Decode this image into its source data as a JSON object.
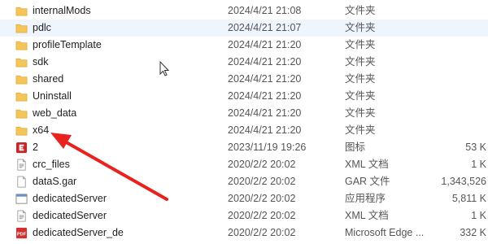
{
  "file_list": {
    "rows": [
      {
        "name": "internalMods",
        "date": "2024/4/21 21:08",
        "type": "文件夹",
        "size": "",
        "icon": "folder-icon"
      },
      {
        "name": "pdlc",
        "date": "2024/4/21 21:07",
        "type": "文件夹",
        "size": "",
        "icon": "folder-icon",
        "selected": true
      },
      {
        "name": "profileTemplate",
        "date": "2024/4/21 21:20",
        "type": "文件夹",
        "size": "",
        "icon": "folder-icon"
      },
      {
        "name": "sdk",
        "date": "2024/4/21 21:20",
        "type": "文件夹",
        "size": "",
        "icon": "folder-icon"
      },
      {
        "name": "shared",
        "date": "2024/4/21 21:20",
        "type": "文件夹",
        "size": "",
        "icon": "folder-icon"
      },
      {
        "name": "Uninstall",
        "date": "2024/4/21 21:20",
        "type": "文件夹",
        "size": "",
        "icon": "folder-icon"
      },
      {
        "name": "web_data",
        "date": "2024/4/21 21:20",
        "type": "文件夹",
        "size": "",
        "icon": "folder-icon"
      },
      {
        "name": "x64",
        "date": "2024/4/21 21:20",
        "type": "文件夹",
        "size": "",
        "icon": "folder-icon"
      },
      {
        "name": "2",
        "date": "2023/11/19 19:26",
        "type": "图标",
        "size": "53 K",
        "icon": "app-icon-file"
      },
      {
        "name": "crc_files",
        "date": "2020/2/2 20:02",
        "type": "XML 文档",
        "size": "1 K",
        "icon": "xml-file-icon"
      },
      {
        "name": "dataS.gar",
        "date": "2020/2/2 20:02",
        "type": "GAR 文件",
        "size": "1,343,526",
        "icon": "generic-file-icon"
      },
      {
        "name": "dedicatedServer",
        "date": "2020/2/2 20:02",
        "type": "应用程序",
        "size": "5,811 K",
        "icon": "exe-file-icon"
      },
      {
        "name": "dedicatedServer",
        "date": "2020/2/2 20:02",
        "type": "XML 文档",
        "size": "1 K",
        "icon": "xml-file-icon"
      },
      {
        "name": "dedicatedServer_de",
        "date": "2020/2/2 20:02",
        "type": "Microsoft Edge ...",
        "size": "332 K",
        "icon": "pdf-file-icon"
      }
    ]
  },
  "annotation": {
    "color": "#e8221f",
    "target": "x64"
  },
  "colors": {
    "folder": "#f4c65a",
    "folder_dark": "#e0a93a",
    "selected_row": "#eef5fd",
    "pdf_red": "#c62828"
  }
}
